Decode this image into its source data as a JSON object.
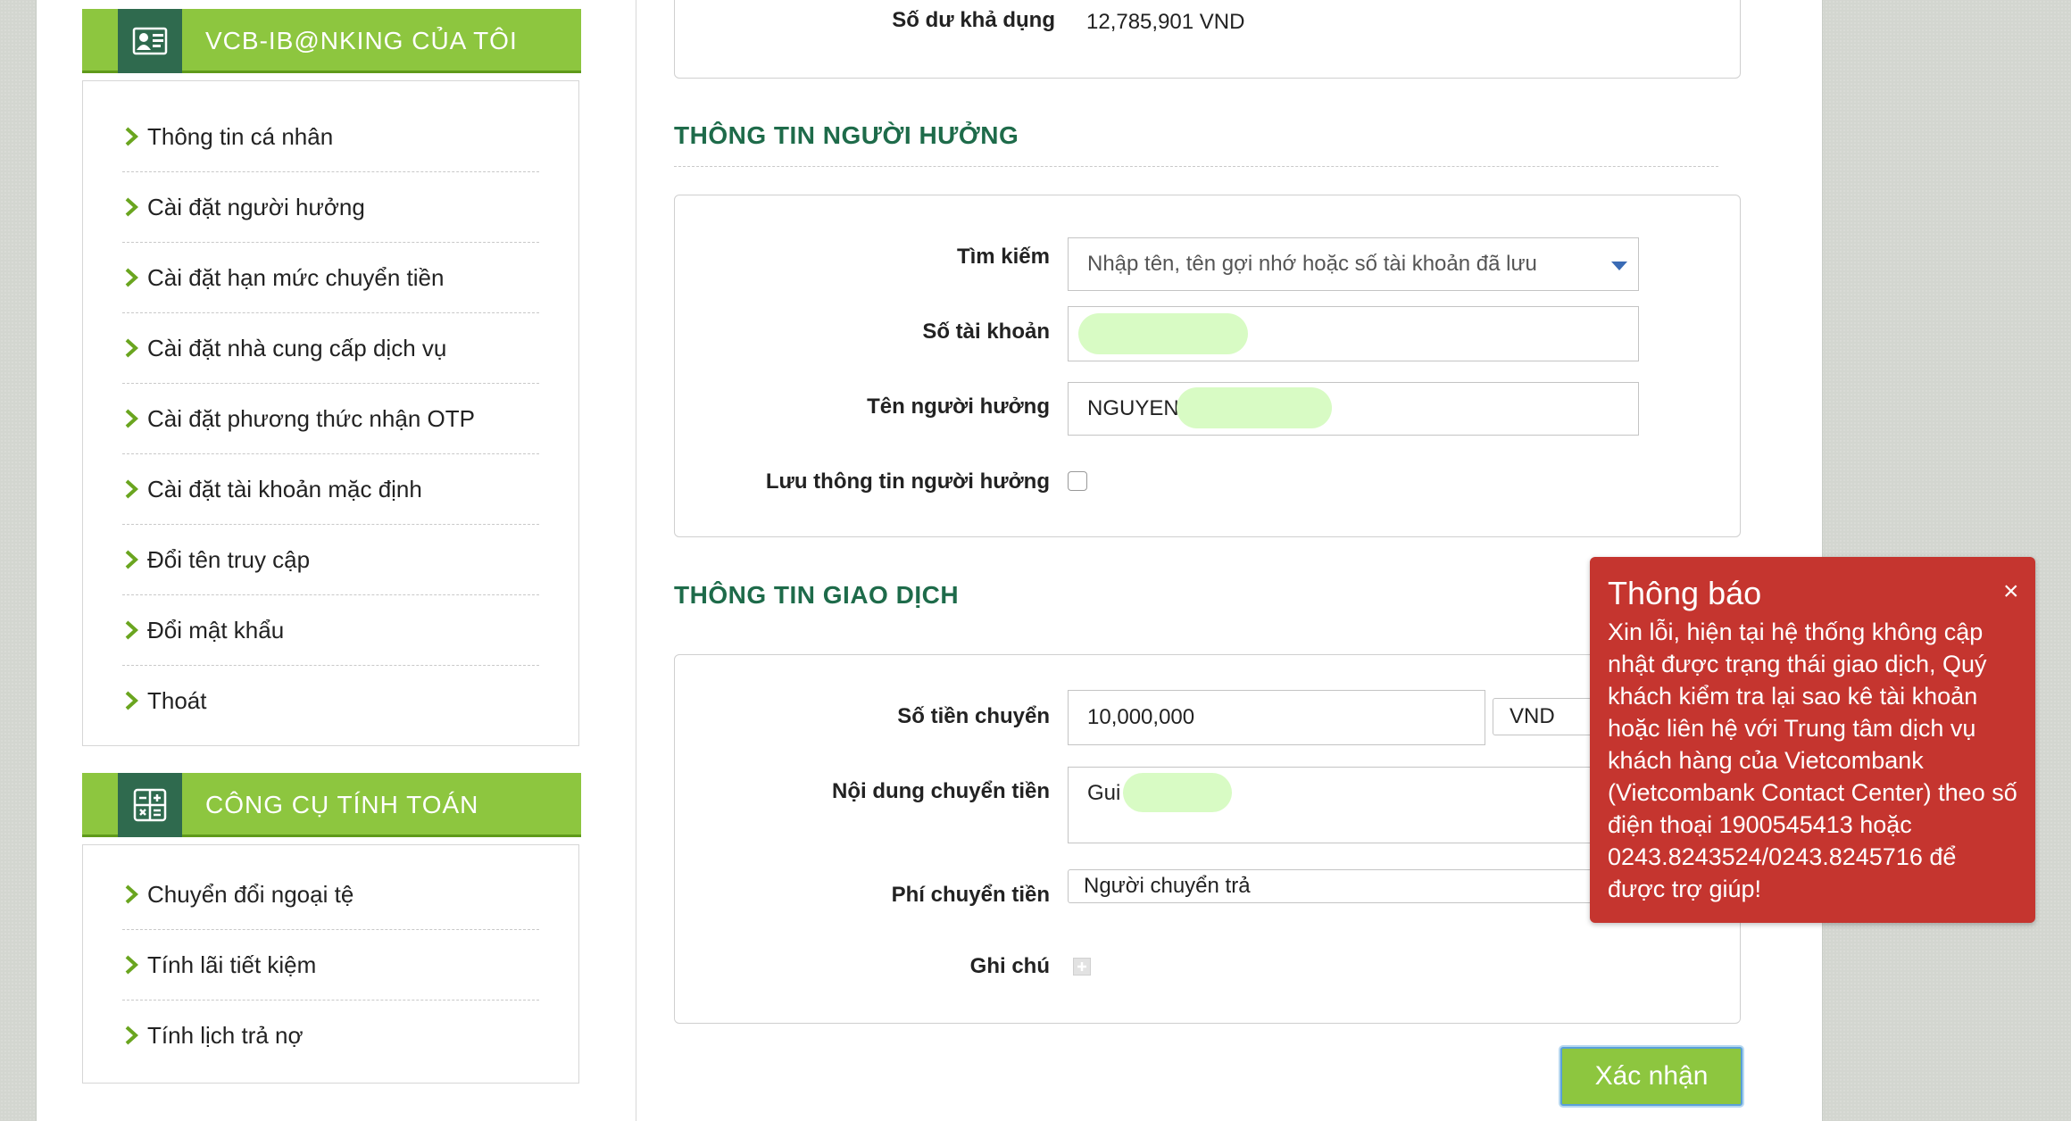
{
  "sidebar": {
    "account_menu": {
      "title": "VCB-IB@NKING CỦA TÔI",
      "icon": "user-card-icon",
      "items": [
        {
          "label": "Thông tin cá nhân"
        },
        {
          "label": "Cài đặt người hưởng"
        },
        {
          "label": "Cài đặt hạn mức chuyển tiền"
        },
        {
          "label": "Cài đặt nhà cung cấp dịch vụ"
        },
        {
          "label": "Cài đặt phương thức nhận OTP"
        },
        {
          "label": "Cài đặt tài khoản mặc định"
        },
        {
          "label": "Đổi tên truy cập"
        },
        {
          "label": "Đổi mật khẩu"
        },
        {
          "label": "Thoát"
        }
      ]
    },
    "tools_menu": {
      "title": "CÔNG CỤ TÍNH TOÁN",
      "icon": "calculator-icon",
      "items": [
        {
          "label": "Chuyển đổi ngoại tệ"
        },
        {
          "label": "Tính lãi tiết kiệm"
        },
        {
          "label": "Tính lịch trả nợ"
        }
      ]
    }
  },
  "balance": {
    "label": "Số dư khả dụng",
    "value": "12,785,901 VND"
  },
  "beneficiary": {
    "section_title": "THÔNG TIN NGƯỜI HƯỞNG",
    "search_label": "Tìm kiếm",
    "search_placeholder": "Nhập tên, tên gợi nhớ hoặc số tài khoản đã lưu",
    "account_label": "Số tài khoản",
    "account_value": "",
    "name_label": "Tên người hưởng",
    "name_value": "NGUYEN",
    "save_label": "Lưu thông tin người hưởng",
    "save_checked": false
  },
  "transaction": {
    "section_title": "THÔNG TIN GIAO DỊCH",
    "amount_label": "Số tiền chuyển",
    "amount_value": "10,000,000",
    "currency": "VND",
    "content_label": "Nội dung chuyển tiền",
    "content_value": "Gui",
    "fee_label": "Phí chuyển tiền",
    "fee_value": "Người chuyển trả",
    "note_label": "Ghi chú"
  },
  "confirm_button": "Xác nhận",
  "notification": {
    "title": "Thông báo",
    "message": "Xin lỗi, hiện tại hệ thống không cập nhật được trạng thái giao dịch, Quý khách kiểm tra lại sao kê tài khoản hoặc liên hệ với Trung tâm dịch vụ khách hàng của Vietcombank (Vietcombank Contact Center) theo số điện thoại 1900545413 hoặc 0243.8243524/0243.8245716 để được trợ giúp!",
    "close": "×"
  },
  "colors": {
    "brand_green": "#8dc63f",
    "brand_dark_green": "#2f6a4e",
    "section_title": "#1e6b4a",
    "toast_red": "#c5352f"
  }
}
